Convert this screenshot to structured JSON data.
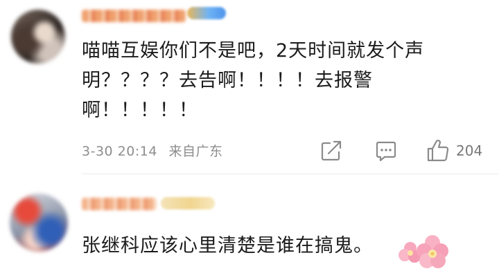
{
  "comments": [
    {
      "username": "**** ****",
      "badge": "***",
      "text": "喵喵互娱你们不是吧，2天时间就发个声明？？？？去告啊！！！！去报警啊！！！！！",
      "timestamp": "3-30 20:14",
      "location": "来自广东",
      "likes": "204",
      "actions": {
        "share_icon": "share-icon",
        "comment_icon": "comment-icon",
        "like_icon": "thumbs-up-icon"
      }
    },
    {
      "username": "**** **",
      "badge": "****",
      "text": "张继科应该心里清楚是谁在搞鬼。",
      "emoji_icon": "cherry-blossom-icon"
    }
  ],
  "colors": {
    "text": "#1b1b1b",
    "meta_text": "#8d8d8d",
    "icon_gray": "#8a8a8a",
    "flower_pink": "#f7a8bc"
  }
}
